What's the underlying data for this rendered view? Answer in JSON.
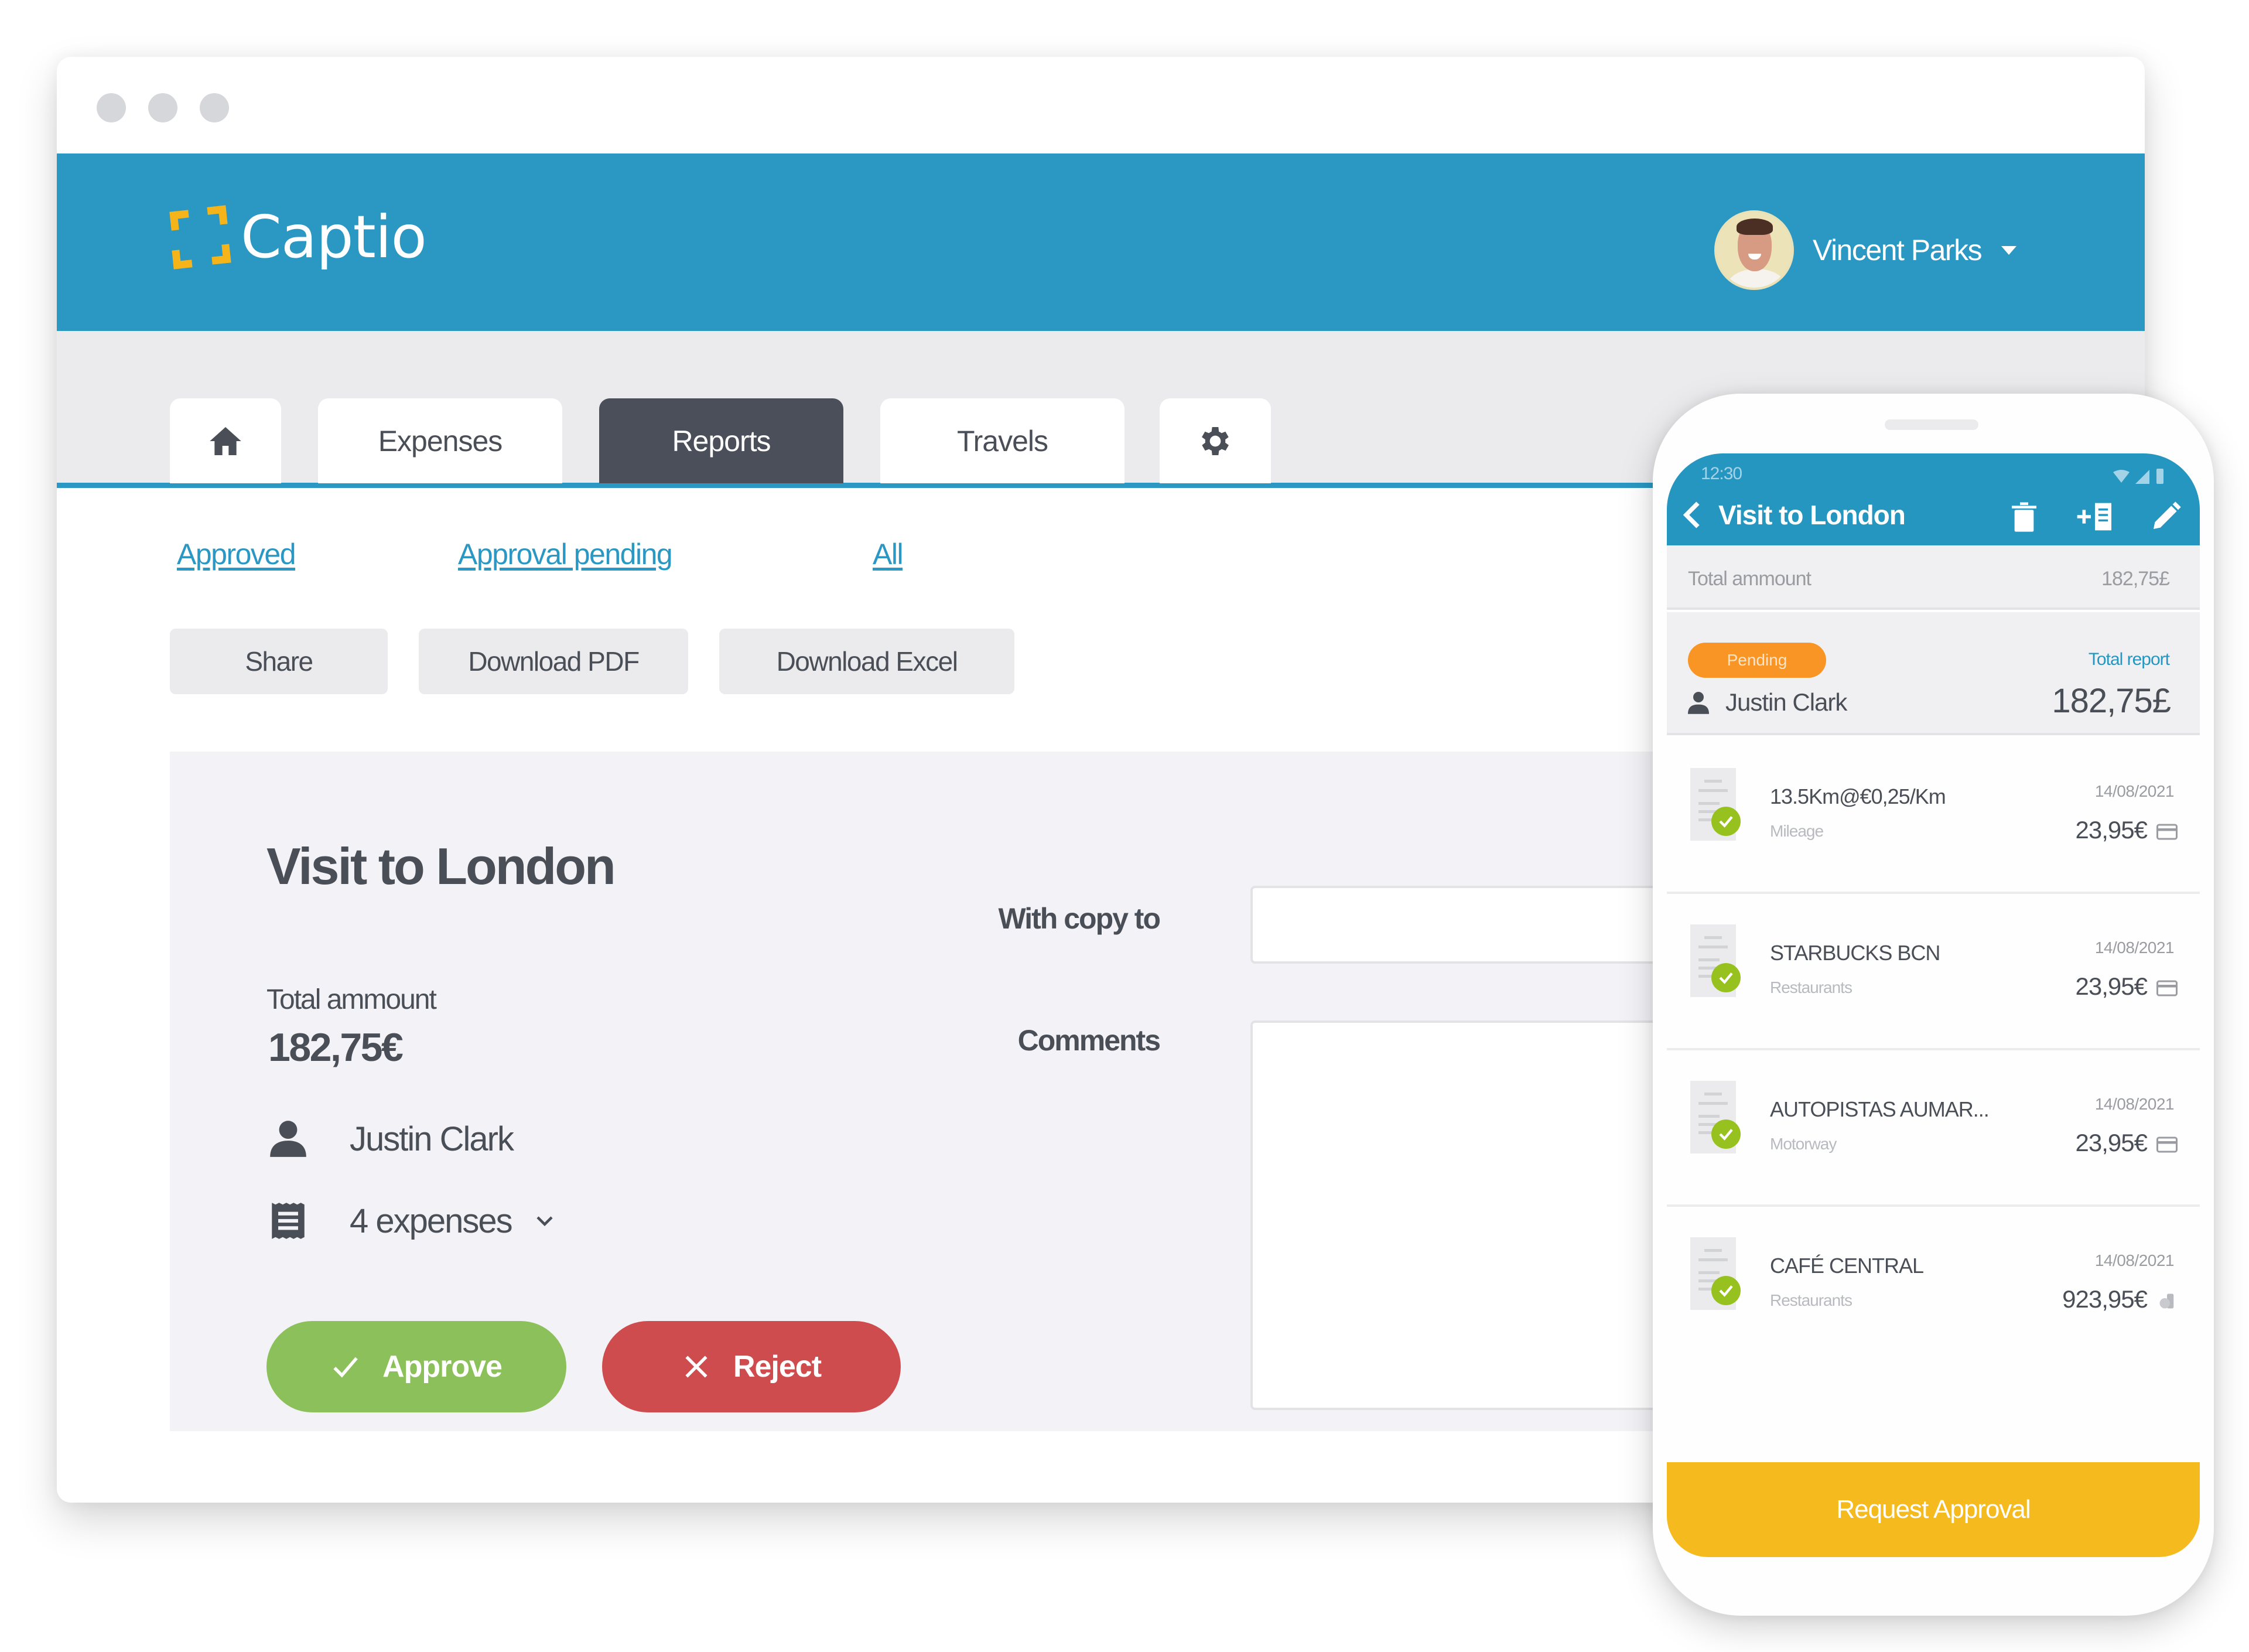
{
  "window": {
    "controls": [
      "close",
      "minimize",
      "maximize"
    ]
  },
  "header": {
    "brand": "Captio",
    "user_name": "Vincent Parks",
    "brand_color": "#2b97c3",
    "accent_color": "#f4b41a"
  },
  "tabs": [
    {
      "id": "home",
      "icon": "home-icon",
      "label": ""
    },
    {
      "id": "expenses",
      "label": "Expenses"
    },
    {
      "id": "reports",
      "label": "Reports",
      "active": true
    },
    {
      "id": "travels",
      "label": "Travels"
    },
    {
      "id": "settings",
      "icon": "gear-icon",
      "label": ""
    }
  ],
  "filters": {
    "approved": "Approved",
    "approval_pending": "Approval pending",
    "all": "All"
  },
  "actions": {
    "share": "Share",
    "download_pdf": "Download PDF",
    "download_excel": "Download Excel"
  },
  "report": {
    "title": "Visit to London",
    "total_label": "Total ammount",
    "total_value": "182,75€",
    "user": "Justin Clark",
    "expenses_count": "4 expenses",
    "approve_label": "Approve",
    "reject_label": "Reject",
    "with_copy_label": "With copy to",
    "with_copy_value": "",
    "comments_label": "Comments",
    "comments_value": ""
  },
  "phone": {
    "time": "12:30",
    "title": "Visit to London",
    "total_label": "Total ammount",
    "total_value": "182,75£",
    "status_badge": "Pending",
    "total_report_label": "Total report",
    "user": "Justin Clark",
    "total_report_value": "182,75£",
    "expenses": [
      {
        "name": "13.5Km@€0,25/Km",
        "category": "Mileage",
        "date": "14/08/2021",
        "amount": "23,95€",
        "payment": "card-icon",
        "status": "approved"
      },
      {
        "name": "STARBUCKS BCN",
        "category": "Restaurants",
        "date": "14/08/2021",
        "amount": "23,95€",
        "payment": "card-icon",
        "status": "approved"
      },
      {
        "name": "AUTOPISTAS AUMAR...",
        "category": "Motorway",
        "date": "14/08/2021",
        "amount": "23,95€",
        "payment": "card-icon",
        "status": "approved"
      },
      {
        "name": "CAFÉ CENTRAL",
        "category": "Restaurants",
        "date": "14/08/2021",
        "amount": "923,95€",
        "payment": "cash-icon",
        "status": "approved"
      }
    ],
    "request_approval_label": "Request Approval"
  }
}
